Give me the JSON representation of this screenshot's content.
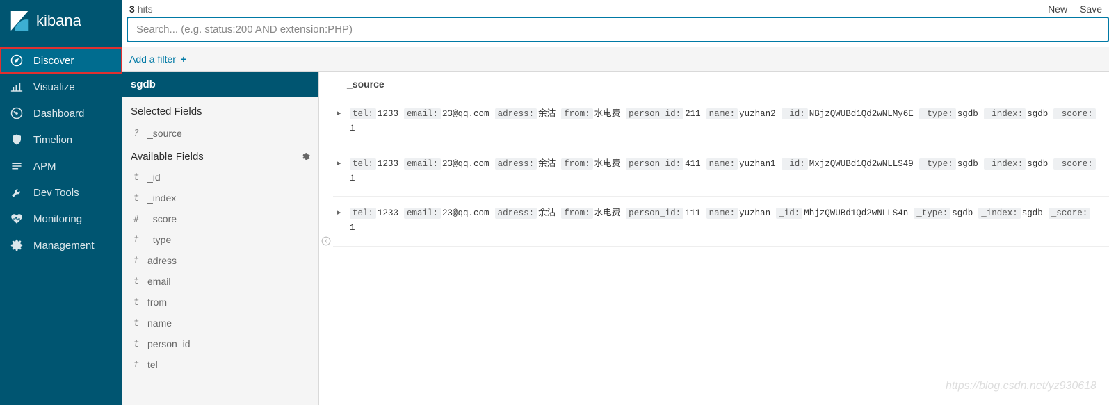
{
  "brand": "kibana",
  "nav": [
    {
      "id": "discover",
      "label": "Discover",
      "icon": "compass",
      "active": true,
      "highlight": true
    },
    {
      "id": "visualize",
      "label": "Visualize",
      "icon": "bar-chart",
      "active": false,
      "highlight": false
    },
    {
      "id": "dashboard",
      "label": "Dashboard",
      "icon": "gauge",
      "active": false,
      "highlight": false
    },
    {
      "id": "timelion",
      "label": "Timelion",
      "icon": "shield",
      "active": false,
      "highlight": false
    },
    {
      "id": "apm",
      "label": "APM",
      "icon": "list",
      "active": false,
      "highlight": false
    },
    {
      "id": "devtools",
      "label": "Dev Tools",
      "icon": "wrench",
      "active": false,
      "highlight": false
    },
    {
      "id": "monitoring",
      "label": "Monitoring",
      "icon": "heartbeat",
      "active": false,
      "highlight": false
    },
    {
      "id": "management",
      "label": "Management",
      "icon": "gear",
      "active": false,
      "highlight": false
    }
  ],
  "hits": {
    "count": "3",
    "label": "hits"
  },
  "top_actions": {
    "new": "New",
    "save": "Save"
  },
  "search": {
    "placeholder": "Search... (e.g. status:200 AND extension:PHP)"
  },
  "filter_bar": {
    "label": "Add a filter",
    "plus": "+"
  },
  "index_pattern": "sgdb",
  "selected_fields_title": "Selected Fields",
  "selected_fields": [
    {
      "type": "?",
      "name": "_source"
    }
  ],
  "available_fields_title": "Available Fields",
  "available_fields": [
    {
      "type": "t",
      "name": "_id"
    },
    {
      "type": "t",
      "name": "_index"
    },
    {
      "type": "#",
      "name": "_score"
    },
    {
      "type": "t",
      "name": "_type"
    },
    {
      "type": "t",
      "name": "adress"
    },
    {
      "type": "t",
      "name": "email"
    },
    {
      "type": "t",
      "name": "from"
    },
    {
      "type": "t",
      "name": "name"
    },
    {
      "type": "t",
      "name": "person_id"
    },
    {
      "type": "t",
      "name": "tel"
    }
  ],
  "results_header": "_source",
  "docs": [
    {
      "tel": "1233",
      "email": "23@qq.com",
      "adress": "余沽",
      "from": "水电费",
      "person_id": "211",
      "name": "yuzhan2",
      "_id": "NBjzQWUBd1Qd2wNLMy6E",
      "_type": "sgdb",
      "_index": "sgdb",
      "_score": "1"
    },
    {
      "tel": "1233",
      "email": "23@qq.com",
      "adress": "余沽",
      "from": "水电费",
      "person_id": "411",
      "name": "yuzhan1",
      "_id": "MxjzQWUBd1Qd2wNLLS49",
      "_type": "sgdb",
      "_index": "sgdb",
      "_score": "1"
    },
    {
      "tel": "1233",
      "email": "23@qq.com",
      "adress": "余沽",
      "from": "水电费",
      "person_id": "111",
      "name": "yuzhan",
      "_id": "MhjzQWUBd1Qd2wNLLS4n",
      "_type": "sgdb",
      "_index": "sgdb",
      "_score": "1"
    }
  ],
  "doc_field_order": [
    "tel",
    "email",
    "adress",
    "from",
    "person_id",
    "name",
    "_id",
    "_type",
    "_index",
    "_score"
  ],
  "watermark": "https://blog.csdn.net/yz930618"
}
